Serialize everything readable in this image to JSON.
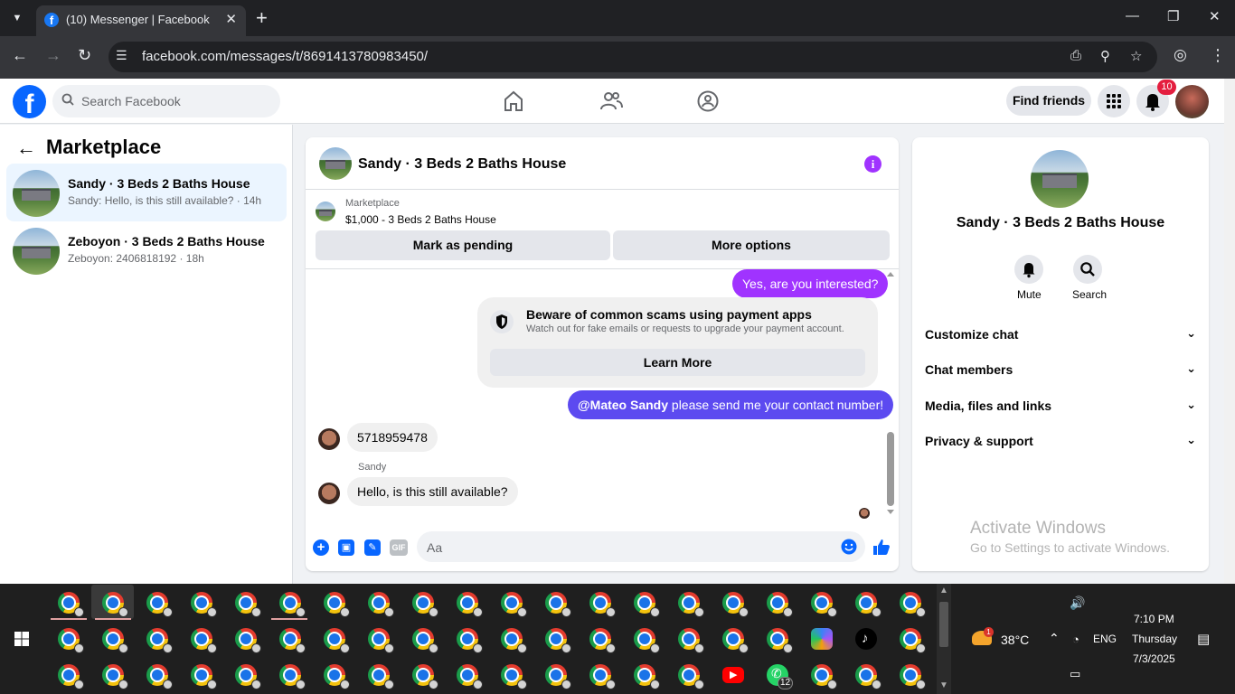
{
  "browser": {
    "tab_title": "(10) Messenger | Facebook",
    "tab_favicon": "f",
    "new_tab": "+",
    "url": "facebook.com/messages/t/8691413780983450/"
  },
  "fb": {
    "search_placeholder": "Search Facebook",
    "find_friends": "Find friends",
    "notif_count": "10"
  },
  "left": {
    "back": "←",
    "title": "Marketplace",
    "conversations": [
      {
        "title": "Sandy · 3 Beds 2 Baths House",
        "preview": "Sandy: Hello, is this still available? · 14h"
      },
      {
        "title": "Zeboyon · 3 Beds 2 Baths House",
        "preview": "Zeboyon: 2406818192 · 18h"
      }
    ]
  },
  "chat": {
    "title": "Sandy · 3 Beds 2 Baths House",
    "info_icon": "i",
    "marketplace_label": "Marketplace",
    "listing": "$1,000 - 3 Beds 2 Baths House",
    "mark_pending": "Mark as pending",
    "more_options": "More options",
    "msg_out_1": "Yes, are you interested?",
    "scam_title": "Beware of common scams using payment apps",
    "scam_sub": "Watch out for fake emails or requests to upgrade your payment account.",
    "learn_more": "Learn More",
    "msg_out_2_mention": "@Mateo Sandy",
    "msg_out_2_rest": " please send me your contact number!",
    "msg_in_1": "5718959478",
    "sender": "Sandy",
    "msg_in_2": "Hello, is this still available?",
    "input_placeholder": "Aa",
    "gif_label": "GIF"
  },
  "right": {
    "name": "Sandy · 3 Beds 2 Baths House",
    "mute": "Mute",
    "search": "Search",
    "sections": [
      "Customize chat",
      "Chat members",
      "Media, files and links",
      "Privacy & support"
    ]
  },
  "watermark": {
    "line1": "Activate Windows",
    "line2": "Go to Settings to activate Windows."
  },
  "taskbar": {
    "temp": "38°C",
    "weather_badge": "1",
    "lang": "ENG",
    "time": "7:10 PM",
    "day": "Thursday",
    "date": "7/3/2025",
    "whatsapp_count": "12"
  },
  "colors": {
    "fb_blue": "#0866ff",
    "purple_bubble": "#a033ff",
    "mention_bubble": "#5c4af0",
    "badge_red": "#e41e3f"
  }
}
